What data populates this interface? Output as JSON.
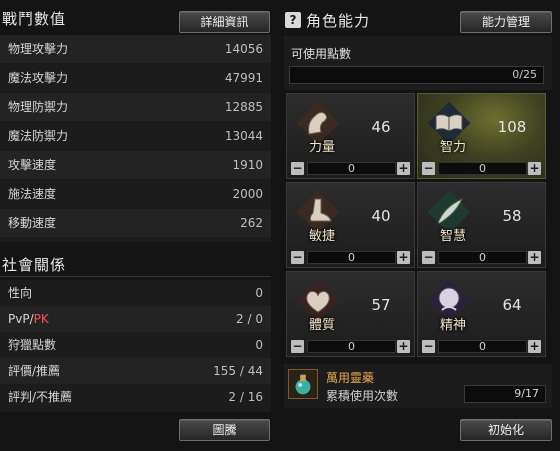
{
  "combat": {
    "title": "戰鬥數值",
    "detail_button": "詳細資訊",
    "stats": [
      {
        "label": "物理攻擊力",
        "value": "14056"
      },
      {
        "label": "魔法攻擊力",
        "value": "47991"
      },
      {
        "label": "物理防禦力",
        "value": "12885"
      },
      {
        "label": "魔法防禦力",
        "value": "13044"
      },
      {
        "label": "攻擊速度",
        "value": "1910"
      },
      {
        "label": "施法速度",
        "value": "2000"
      },
      {
        "label": "移動速度",
        "value": "262"
      }
    ]
  },
  "social": {
    "title": "社會關係",
    "rows": [
      {
        "label": "性向",
        "value": "0"
      },
      {
        "label_pvp": "PvP/",
        "label_pk": "PK",
        "value": "2 / 0"
      },
      {
        "label": "狩獵點數",
        "value": "0"
      },
      {
        "label": "評價/推薦",
        "value": "155 / 44"
      },
      {
        "label": "評判/不推薦",
        "value": "2 / 16"
      }
    ],
    "emblem_button": "圖騰"
  },
  "abilities": {
    "title": "角色能力",
    "help_icon": "?",
    "manage_button": "能力管理",
    "available_points_label": "可使用點數",
    "available_points_value": "0/25",
    "attributes": [
      {
        "name": "力量",
        "value": "46",
        "alloc": "0",
        "icon": "arm-icon"
      },
      {
        "name": "智力",
        "value": "108",
        "alloc": "0",
        "icon": "book-icon"
      },
      {
        "name": "敏捷",
        "value": "40",
        "alloc": "0",
        "icon": "foot-icon"
      },
      {
        "name": "智慧",
        "value": "58",
        "alloc": "0",
        "icon": "feather-icon"
      },
      {
        "name": "體質",
        "value": "57",
        "alloc": "0",
        "icon": "heart-icon"
      },
      {
        "name": "精神",
        "value": "64",
        "alloc": "0",
        "icon": "mind-icon"
      }
    ],
    "stepper_minus": "−",
    "stepper_plus": "+",
    "potion": {
      "name": "萬用靈藥",
      "desc": "累積使用次數",
      "count": "9/17"
    },
    "reset_button": "初始化"
  }
}
